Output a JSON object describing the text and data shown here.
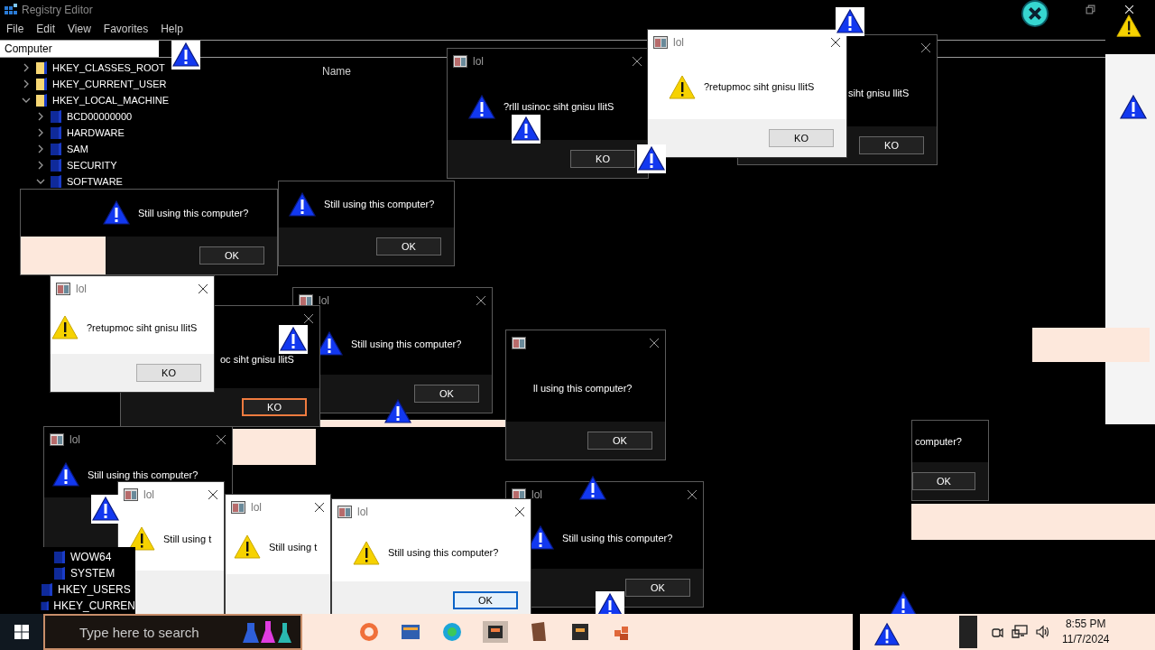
{
  "registry_editor": {
    "title": "Registry Editor",
    "menu": [
      "File",
      "Edit",
      "View",
      "Favorites",
      "Help"
    ],
    "address": "Computer",
    "column_header": "Name",
    "tree": [
      {
        "label": "HKEY_CLASSES_ROOT",
        "expanded": false
      },
      {
        "label": "HKEY_CURRENT_USER",
        "expanded": false
      },
      {
        "label": "HKEY_LOCAL_MACHINE",
        "expanded": true,
        "children": [
          {
            "label": "BCD00000000",
            "expanded": false
          },
          {
            "label": "HARDWARE",
            "expanded": false
          },
          {
            "label": "SAM",
            "expanded": false
          },
          {
            "label": "SECURITY",
            "expanded": false
          },
          {
            "label": "SOFTWARE",
            "expanded": true
          }
        ]
      }
    ],
    "tree_lower": [
      {
        "kind": "subkey",
        "label": "WOW64"
      },
      {
        "kind": "subkey",
        "label": "SYSTEM"
      },
      {
        "kind": "hive",
        "label": "HKEY_USERS"
      },
      {
        "kind": "hive",
        "label": "HKEY_CURREN"
      }
    ]
  },
  "dialogs": [
    {
      "kind": "dark",
      "message": "Still using this computer?",
      "button": "OK",
      "focused": false
    },
    {
      "kind": "dark",
      "message": "Still using this computer?",
      "button": "OK",
      "focused": false
    },
    {
      "kind": "dark",
      "title": "lol",
      "message": "?rlll usinoc siht gnisu llitS",
      "button": "KO",
      "focused": false
    },
    {
      "kind": "dark",
      "message": "siht gnisu llitS",
      "button": "KO",
      "focused": false
    },
    {
      "kind": "light",
      "title": "lol",
      "message": "?retupmoc siht gnisu llitS",
      "button": "KO",
      "focused": false
    },
    {
      "kind": "dark",
      "title": "lol",
      "message": "Still using this computer?",
      "button": "OK",
      "focused": false
    },
    {
      "kind": "dark",
      "message": "oc siht gnisu llitS",
      "button": "KO",
      "focused": true
    },
    {
      "kind": "light",
      "title": "lol",
      "message": "?retupmoc siht gnisu llitS",
      "button": "KO",
      "focused": false
    },
    {
      "kind": "dark",
      "message": "ll using this computer?",
      "button": "OK",
      "focused": false
    },
    {
      "kind": "dark",
      "title": "lol",
      "message": "Still using this computer?"
    },
    {
      "kind": "dark",
      "message": "computer?",
      "button": "OK",
      "focused": false
    },
    {
      "kind": "light",
      "title": "lol",
      "message": "Still using t"
    },
    {
      "kind": "light",
      "title": "lol",
      "message": "Still using t"
    },
    {
      "kind": "light",
      "title": "lol",
      "message": "Still using this computer?",
      "button": "OK",
      "focused": true
    },
    {
      "kind": "dark",
      "title": "lol",
      "message": "Still using this computer?",
      "button": "OK",
      "focused": false
    }
  ],
  "taskbar": {
    "search": {
      "placeholder": "Type here to search"
    },
    "clock": {
      "time": "8:55 PM",
      "date": "11/7/2024"
    }
  }
}
